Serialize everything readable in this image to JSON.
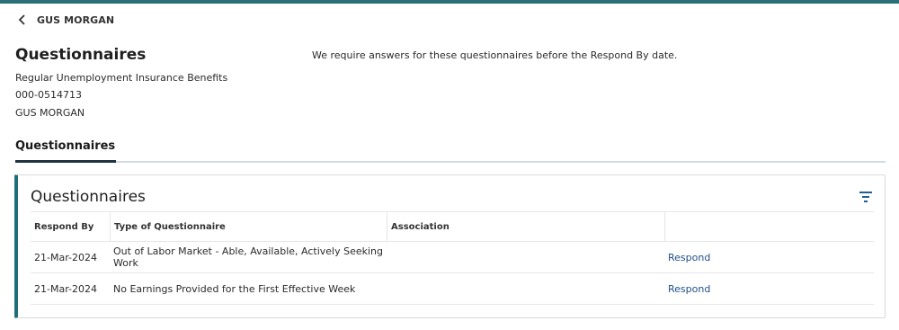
{
  "colors": {
    "accent": "#2a6f77",
    "link": "#1f4f87"
  },
  "header": {
    "back_label": "GUS MORGAN",
    "back_icon": "chevron-left-icon"
  },
  "page": {
    "title": "Questionnaires",
    "notice": "We require answers for these questionnaires before the Respond By date.",
    "program": "Regular Unemployment Insurance Benefits",
    "claim_id": "000-0514713",
    "claimant": "GUS MORGAN"
  },
  "tabs": [
    {
      "label": "Questionnaires",
      "active": true
    }
  ],
  "card": {
    "title": "Questionnaires",
    "filter_icon": "filter-icon",
    "columns": [
      "Respond By",
      "Type of Questionnaire",
      "Association",
      ""
    ],
    "rows": [
      {
        "respond_by": "21-Mar-2024",
        "type": "Out of Labor Market - Able, Available, Actively Seeking Work",
        "association": "",
        "action": "Respond"
      },
      {
        "respond_by": "21-Mar-2024",
        "type": "No Earnings Provided for the First Effective Week",
        "association": "",
        "action": "Respond"
      }
    ]
  }
}
